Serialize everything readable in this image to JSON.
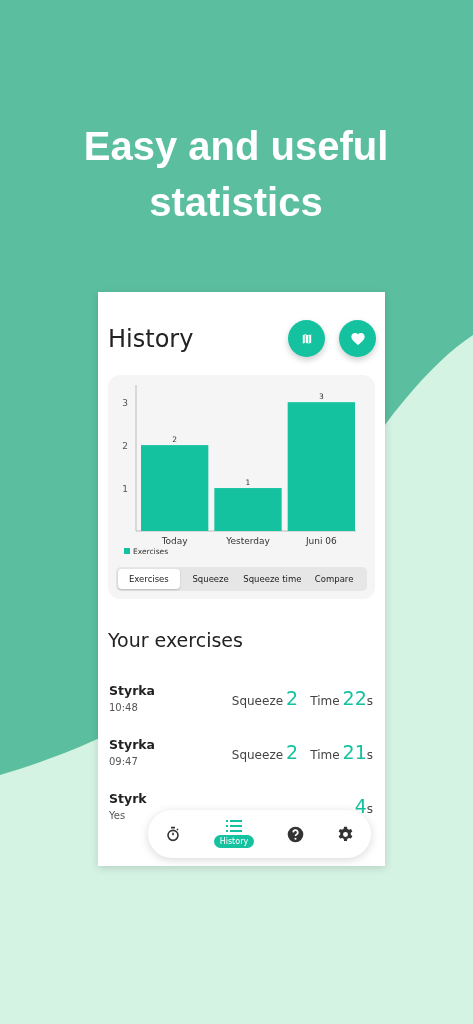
{
  "headline": "Easy and useful statistics",
  "screen": {
    "title": "History",
    "action_buttons": [
      {
        "kind": "map"
      },
      {
        "kind": "heart"
      }
    ],
    "chart": {
      "chart_data": {
        "type": "bar",
        "categories": [
          "Today",
          "Yesterday",
          "Juni 06"
        ],
        "series": [
          {
            "name": "Exercises",
            "color": "#14c2a0",
            "values": [
              2,
              1,
              3
            ]
          }
        ],
        "ylim": [
          0,
          3.4
        ],
        "yticks": [
          1,
          2,
          3
        ],
        "data_labels": true
      }
    },
    "segments": [
      {
        "label": "Exercises",
        "selected": true
      },
      {
        "label": "Squeeze",
        "selected": false
      },
      {
        "label": "Squeeze time",
        "selected": false
      },
      {
        "label": "Compare",
        "selected": false
      }
    ],
    "section_title": "Your exercises",
    "exercises": [
      {
        "name": "Styrka",
        "time": "10:48",
        "squeeze_label": "Squeeze",
        "squeeze": "2",
        "time_label": "Time",
        "duration": "22",
        "unit": "s"
      },
      {
        "name": "Styrka",
        "time": "09:47",
        "squeeze_label": "Squeeze",
        "squeeze": "2",
        "time_label": "Time",
        "duration": "21",
        "unit": "s"
      },
      {
        "name": "Styrk",
        "time": "Yes",
        "duration": "4",
        "unit": "s"
      }
    ],
    "nav": [
      {
        "kind": "timer",
        "selected": false
      },
      {
        "kind": "list",
        "label": "History",
        "selected": true
      },
      {
        "kind": "help",
        "selected": false
      },
      {
        "kind": "settings",
        "selected": false
      }
    ]
  }
}
